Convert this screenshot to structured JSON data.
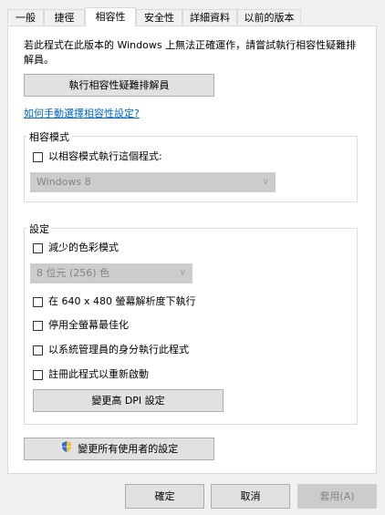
{
  "tabs": [
    {
      "label": "一般"
    },
    {
      "label": "捷徑"
    },
    {
      "label": "相容性"
    },
    {
      "label": "安全性"
    },
    {
      "label": "詳細資料"
    },
    {
      "label": "以前的版本"
    }
  ],
  "description": "若此程式在此版本的 Windows 上無法正確運作，請嘗試執行相容性疑難排解員。",
  "troubleshooter_button": "執行相容性疑難排解員",
  "manual_link": "如何手動選擇相容性設定?",
  "compat_mode": {
    "title": "相容模式",
    "checkbox_label": "以相容模式執行這個程式:",
    "select_value": "Windows 8"
  },
  "settings": {
    "title": "設定",
    "reduced_color_label": "減少的色彩模式",
    "color_select_value": "8 位元 (256) 色",
    "resolution_label": "在 640 x 480 螢幕解析度下執行",
    "disable_fullscreen_label": "停用全螢幕最佳化",
    "run_as_admin_label": "以系統管理員的身分執行此程式",
    "register_restart_label": "註冊此程式以重新啟動",
    "dpi_button": "變更高 DPI 設定"
  },
  "all_users_button": "變更所有使用者的設定",
  "footer": {
    "ok": "確定",
    "cancel": "取消",
    "apply": "套用(A)"
  },
  "icons": {
    "uac_shield": "uac-shield-icon",
    "dropdown_arrow": "chevron-down-icon"
  }
}
